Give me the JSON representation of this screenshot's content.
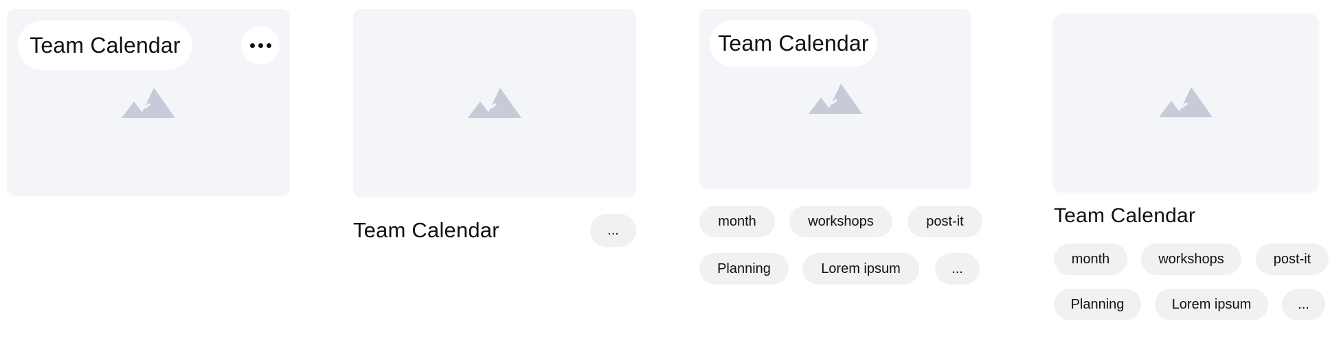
{
  "cards": [
    {
      "title": "Team Calendar",
      "more_icon": "more-horizontal-icon",
      "image_icon": "image-placeholder-icon"
    },
    {
      "title": "Team Calendar",
      "more_label": "...",
      "image_icon": "image-placeholder-icon"
    },
    {
      "title": "Team Calendar",
      "image_icon": "image-placeholder-icon",
      "tags": [
        "month",
        "workshops",
        "post-it",
        "Planning",
        "Lorem ipsum",
        "..."
      ]
    },
    {
      "title": "Team Calendar",
      "image_icon": "image-placeholder-icon",
      "tags": [
        "month",
        "workshops",
        "post-it",
        "Planning",
        "Lorem ipsum",
        "..."
      ]
    }
  ],
  "colors": {
    "thumb_bg": "#f4f5f8",
    "icon": "#c6cad9",
    "chip_bg": "#f1f1f3",
    "text": "#111111"
  }
}
